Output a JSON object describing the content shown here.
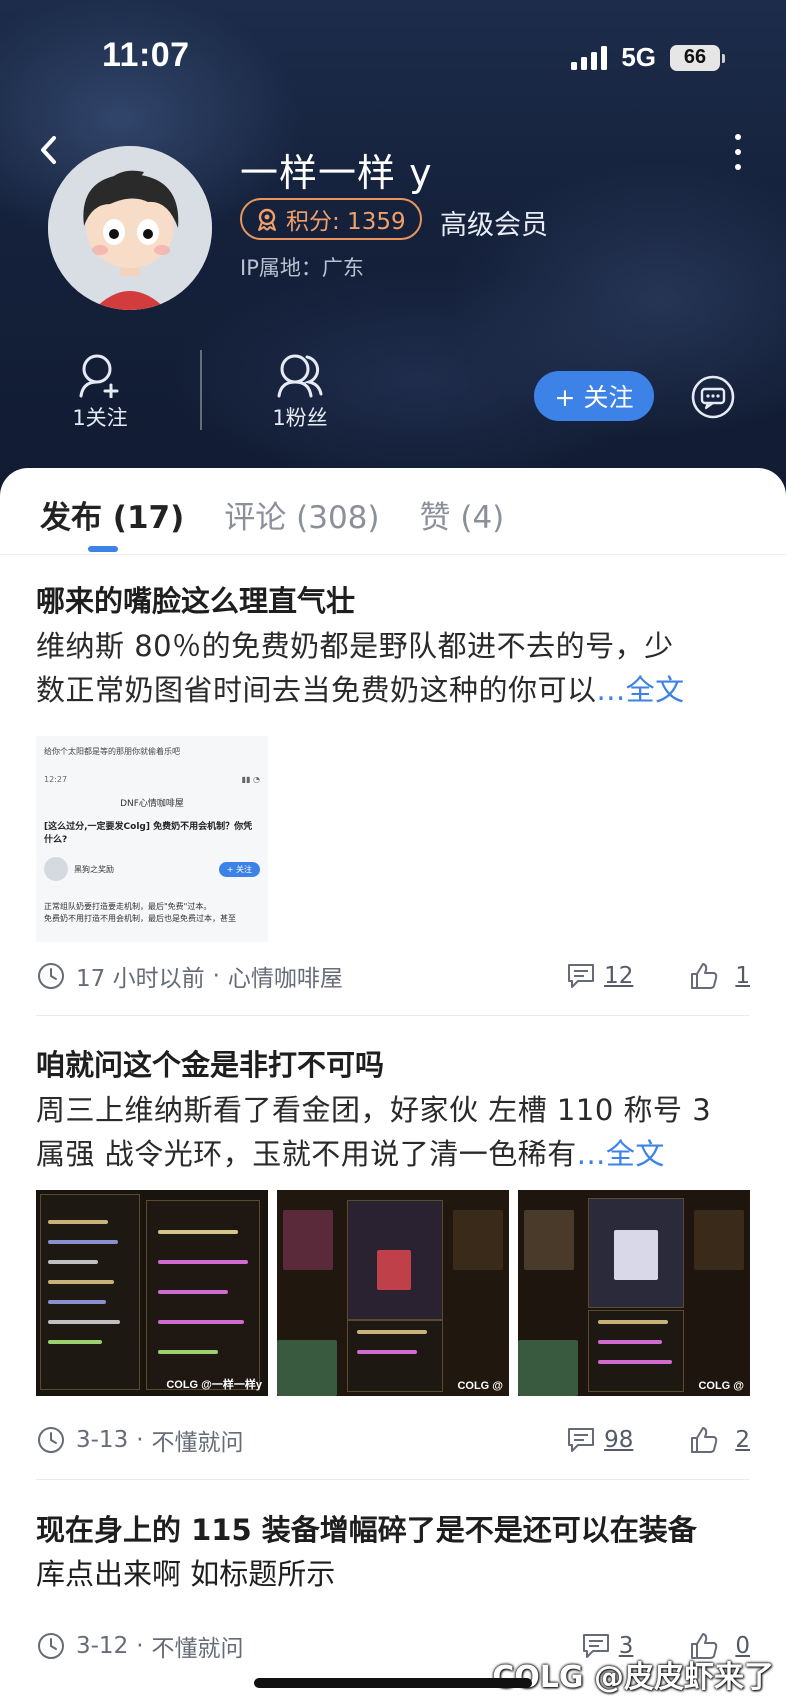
{
  "status_bar": {
    "time": "11:07",
    "network": "5G",
    "battery": "66"
  },
  "profile": {
    "username": "一样一样 y",
    "points_label": "积分: 1359",
    "member_level": "高级会员",
    "ip_location": "IP属地：广东",
    "stats": {
      "following": "1关注",
      "followers": "1粉丝"
    },
    "follow_button": "+ 关注"
  },
  "tabs": [
    {
      "label": "发布 (17)",
      "active": true
    },
    {
      "label": "评论 (308)",
      "active": false
    },
    {
      "label": "赞 (4)",
      "active": false
    }
  ],
  "posts": [
    {
      "title": "哪来的嘴脸这么理直气壮",
      "body_line1": "维纳斯 80％的免费奶都是野队都进不去的号，少",
      "body_line2": "数正常奶图省时间去当免费奶这种的你可以",
      "more": "...全文",
      "time": "17 小时以前",
      "board": "心情咖啡屋",
      "comments": "12",
      "likes": "1",
      "thumbnail": {
        "caption": "给你个太阳都是等的那朋你就偷着乐吧",
        "time": "12:27",
        "header": "DNF心情咖啡屋",
        "title": "[这么过分,一定要发Colg] 免费奶不用会机制？你凭什么?",
        "author": "黑狗之奖励",
        "follow": "+ 关注",
        "text1": "正常组队奶要打造要走机制，最后\"免费\"过本。",
        "text2": "免费奶不用打造不用会机制，最后也是免费过本，甚至"
      }
    },
    {
      "title": "咱就问这个金是非打不可吗",
      "body_line1": "周三上维纳斯看了看金团，好家伙 左槽 110 称号 3",
      "body_line2": "属强 战令光环，玉就不用说了清一色稀有",
      "more": "...全文",
      "time": "3-13",
      "board": "不懂就问",
      "comments": "98",
      "likes": "2",
      "image_watermarks": [
        "COLG @一样一样y",
        "COLG @",
        "COLG @"
      ]
    },
    {
      "title_line1": "现在身上的 115 装备增幅碎了是不是还可以在装备",
      "title_line2": "库点出来啊 如标题所示",
      "time": "3-12",
      "board": "不懂就问",
      "comments": "3",
      "likes": "0"
    }
  ],
  "meta_separator": "·",
  "watermark": "COLG @皮皮虾来了",
  "colors": {
    "accent": "#3d82e6",
    "badge": "#e9955d",
    "header_bg": "#15213b"
  }
}
